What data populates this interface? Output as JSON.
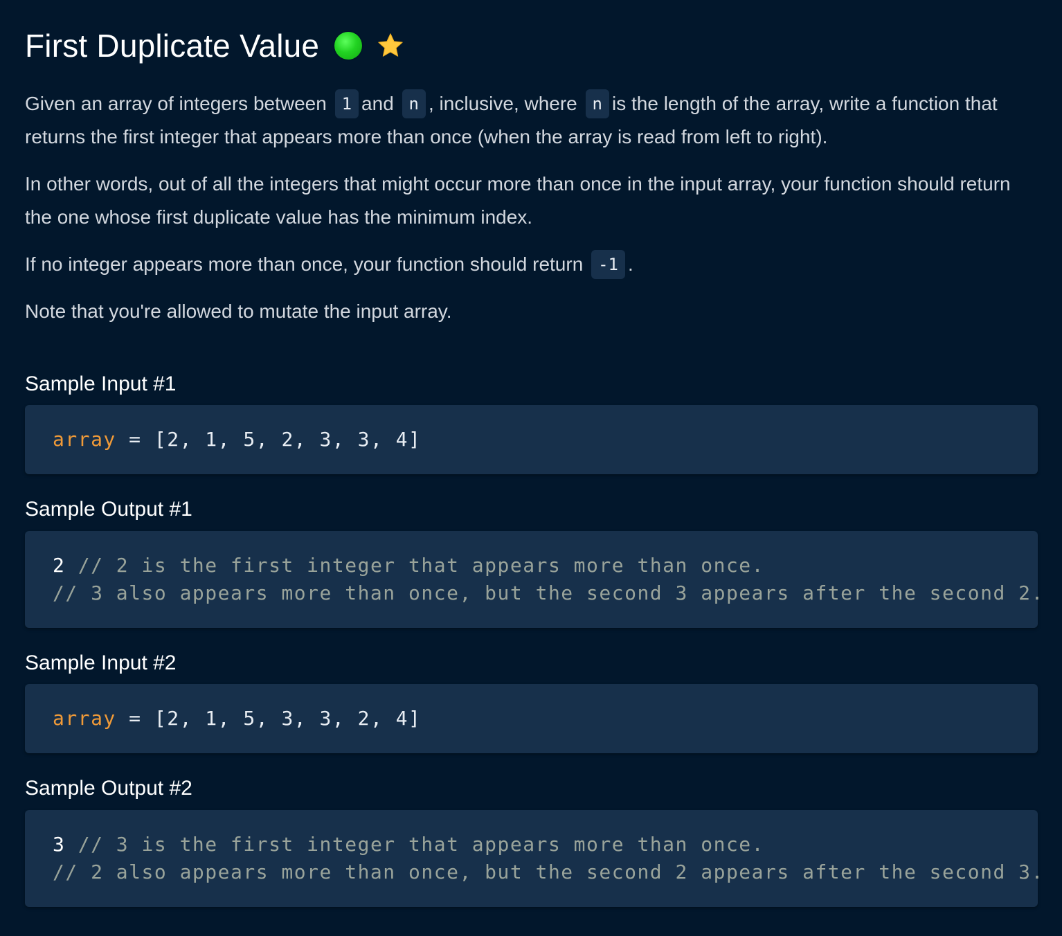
{
  "title": "First Duplicate Value",
  "description": {
    "p1": {
      "t1": "Given an array of integers between",
      "c1": "1",
      "t2": "and",
      "c2": "n",
      "t3": ", inclusive, where",
      "c3": "n",
      "t4": "is the length of the array, write a function that returns the first integer that appears more than once (when the array is read from left to right)."
    },
    "p2": "In other words, out of all the integers that might occur more than once in the input array, your function should return the one whose first duplicate value has the minimum index.",
    "p3": {
      "t1": "If no integer appears more than once, your function should return",
      "c1": "-1",
      "t2": "."
    },
    "p4": "Note that you're allowed to mutate the input array."
  },
  "samples": {
    "input1": {
      "heading": "Sample Input #1",
      "var": "array",
      "rest": " = [2, 1, 5, 2, 3, 3, 4]"
    },
    "output1": {
      "heading": "Sample Output #1",
      "value": "2",
      "comment1": " // 2 is the first integer that appears more than once.",
      "comment2": "// 3 also appears more than once, but the second 3 appears after the second 2."
    },
    "input2": {
      "heading": "Sample Input #2",
      "var": "array",
      "rest": " = [2, 1, 5, 3, 3, 2, 4]"
    },
    "output2": {
      "heading": "Sample Output #2",
      "value": "3",
      "comment1": " // 3 is the first integer that appears more than once.",
      "comment2": "// 2 also appears more than once, but the second 2 appears after the second 3."
    }
  },
  "icons": {
    "difficulty": "green-circle-icon",
    "favorite": "star-icon"
  },
  "colors": {
    "background": "#02172c",
    "code_background": "#17304b",
    "variable": "#f09a38",
    "comment": "#99a39a",
    "difficulty_green": "#22d322",
    "star": "#ffc83d"
  }
}
